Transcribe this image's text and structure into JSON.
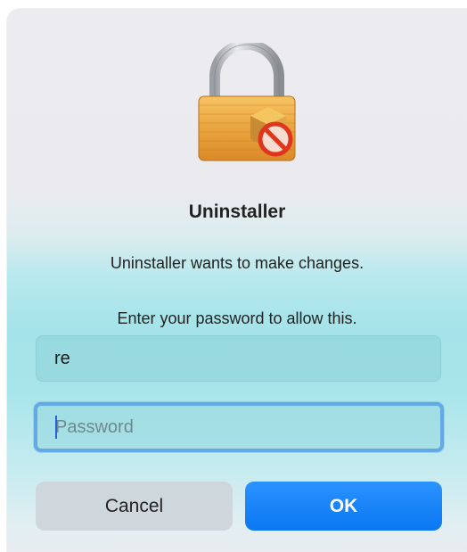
{
  "dialog": {
    "title": "Uninstaller",
    "message": "Uninstaller wants to make changes.",
    "prompt": "Enter your password to allow this.",
    "icon": "lock-package-icon"
  },
  "fields": {
    "username_value": "re",
    "password_placeholder": "Password"
  },
  "buttons": {
    "cancel_label": "Cancel",
    "ok_label": "OK"
  },
  "colors": {
    "accent": "#0a7bf5",
    "focus_ring": "#62a9e6"
  }
}
